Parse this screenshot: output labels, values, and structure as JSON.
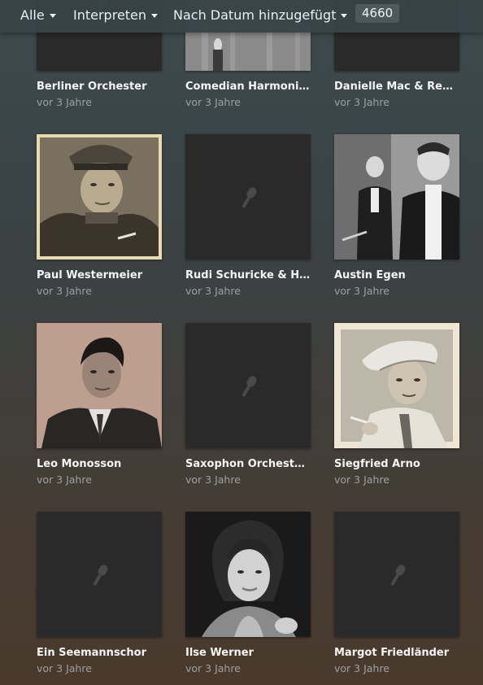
{
  "toolbar": {
    "filter_label": "Alle",
    "type_label": "Interpreten",
    "sort_label": "Nach Datum hinzugefügt",
    "count": "4660"
  },
  "artists": [
    {
      "name": "Berliner Orchester",
      "added": "vor 3 Jahre",
      "thumb": "placeholder"
    },
    {
      "name": "Comedian Harmonists",
      "added": "vor 3 Jahre",
      "thumb": "photo"
    },
    {
      "name": "Danielle Mac & Rene Ca...",
      "added": "vor 3 Jahre",
      "thumb": "placeholder"
    },
    {
      "name": "Paul Westermeier",
      "added": "vor 3 Jahre",
      "thumb": "photo"
    },
    {
      "name": "Rudi Schuricke & Helm...",
      "added": "vor 3 Jahre",
      "thumb": "placeholder"
    },
    {
      "name": "Austin Egen",
      "added": "vor 3 Jahre",
      "thumb": "photo"
    },
    {
      "name": "Leo Monosson",
      "added": "vor 3 Jahre",
      "thumb": "photo"
    },
    {
      "name": "Saxophon Orchester D...",
      "added": "vor 3 Jahre",
      "thumb": "placeholder"
    },
    {
      "name": "Siegfried Arno",
      "added": "vor 3 Jahre",
      "thumb": "photo"
    },
    {
      "name": "Ein Seemannschor",
      "added": "vor 3 Jahre",
      "thumb": "placeholder"
    },
    {
      "name": "Ilse Werner",
      "added": "vor 3 Jahre",
      "thumb": "photo"
    },
    {
      "name": "Margot Friedländer",
      "added": "vor 3 Jahre",
      "thumb": "placeholder"
    }
  ],
  "colors": {
    "placeholder_bg": "#2a2a2a",
    "placeholder_icon": "#4a4a4a"
  }
}
